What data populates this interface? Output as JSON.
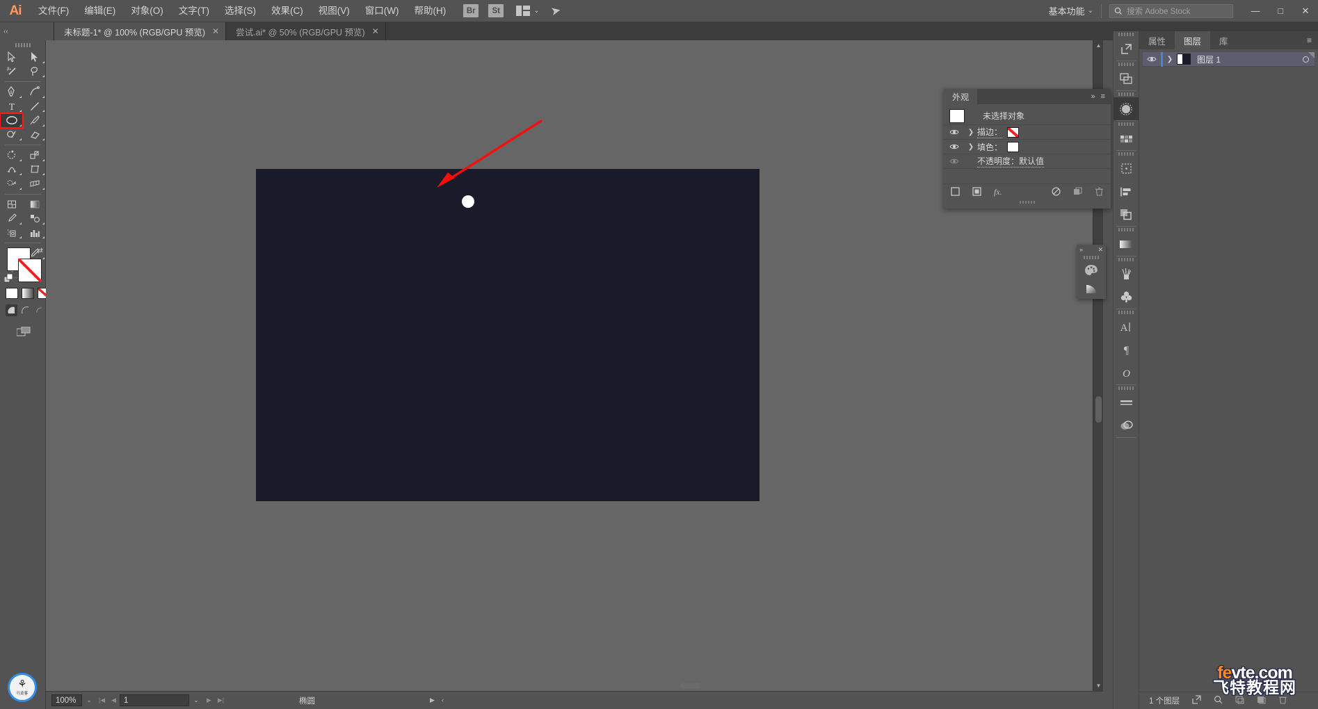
{
  "app": {
    "name": "Adobe Illustrator",
    "logo_text": "Ai",
    "accent_color": "#ff9a5c",
    "chrome_bg": "#535353"
  },
  "menubar": {
    "items": [
      {
        "label": "文件(F)",
        "name": "menu-file"
      },
      {
        "label": "编辑(E)",
        "name": "menu-edit"
      },
      {
        "label": "对象(O)",
        "name": "menu-object"
      },
      {
        "label": "文字(T)",
        "name": "menu-type"
      },
      {
        "label": "选择(S)",
        "name": "menu-select"
      },
      {
        "label": "效果(C)",
        "name": "menu-effect"
      },
      {
        "label": "视图(V)",
        "name": "menu-view"
      },
      {
        "label": "窗口(W)",
        "name": "menu-window"
      },
      {
        "label": "帮助(H)",
        "name": "menu-help"
      }
    ],
    "bridge_label": "Br",
    "stock_label": "St",
    "workspace": "基本功能",
    "search_placeholder": "搜索 Adobe Stock",
    "window_controls": {
      "minimize": "—",
      "maximize": "□",
      "close": "✕"
    }
  },
  "tabs": [
    {
      "title": "未标题-1* @ 100% (RGB/GPU 预览)",
      "active": true,
      "close": "✕"
    },
    {
      "title": "尝试.ai* @ 50% (RGB/GPU 预览)",
      "active": false,
      "close": "✕"
    }
  ],
  "toolbar": {
    "tools": [
      {
        "name": "selection-tool",
        "label": "选择工具"
      },
      {
        "name": "direct-selection-tool",
        "label": "直接选择工具"
      },
      {
        "name": "magic-wand-tool",
        "label": "魔棒工具"
      },
      {
        "name": "lasso-tool",
        "label": "套索工具"
      },
      {
        "name": "pen-tool",
        "label": "钢笔工具"
      },
      {
        "name": "curvature-tool",
        "label": "曲率工具"
      },
      {
        "name": "type-tool",
        "label": "文字工具"
      },
      {
        "name": "line-segment-tool",
        "label": "直线段工具"
      },
      {
        "name": "ellipse-tool",
        "label": "椭圆工具",
        "selected": true
      },
      {
        "name": "paintbrush-tool",
        "label": "画笔工具"
      },
      {
        "name": "shaper-tool",
        "label": "Shaper 工具"
      },
      {
        "name": "eraser-tool",
        "label": "橡皮擦工具"
      },
      {
        "name": "rotate-tool",
        "label": "旋转工具"
      },
      {
        "name": "scale-tool",
        "label": "比例缩放工具"
      },
      {
        "name": "width-tool",
        "label": "宽度工具"
      },
      {
        "name": "free-transform-tool",
        "label": "自由变换工具"
      },
      {
        "name": "shape-builder-tool",
        "label": "形状生成器工具"
      },
      {
        "name": "perspective-grid-tool",
        "label": "透视网格工具"
      },
      {
        "name": "mesh-tool",
        "label": "网格工具"
      },
      {
        "name": "gradient-tool",
        "label": "渐变工具"
      },
      {
        "name": "eyedropper-tool",
        "label": "吸管工具"
      },
      {
        "name": "blend-tool",
        "label": "混合工具"
      },
      {
        "name": "symbol-sprayer-tool",
        "label": "符号喷枪工具"
      },
      {
        "name": "column-graph-tool",
        "label": "柱形图工具"
      },
      {
        "name": "artboard-tool",
        "label": "画板工具"
      },
      {
        "name": "slice-tool",
        "label": "切片工具"
      },
      {
        "name": "hand-tool",
        "label": "抓手工具"
      },
      {
        "name": "zoom-tool",
        "label": "缩放工具"
      }
    ],
    "fill_color": "#ffffff",
    "stroke_color": "none",
    "selection_highlight_color": "#ff1a1a",
    "mini_swatches": [
      "色板",
      "渐变",
      "无"
    ],
    "draw_modes": [
      "正常绘图",
      "背面绘图",
      "内部绘图"
    ]
  },
  "brand_badge": {
    "symbol": "🦌",
    "text": "行走客"
  },
  "canvas": {
    "artboard_color": "#191a2a",
    "background_color": "#666666",
    "shape": {
      "name": "ellipse",
      "fill": "#ffffff",
      "label": "白色圆形"
    },
    "annotation": {
      "type": "arrow",
      "color": "#ff0000"
    }
  },
  "appearance_panel": {
    "tab_label": "外观",
    "collapse": "»",
    "menu": "≡",
    "no_selection": "未选择对象",
    "rows": [
      {
        "label": "描边：",
        "swatch": "none",
        "expandable": true,
        "visible": true
      },
      {
        "label": "填色：",
        "swatch": "#ffffff",
        "expandable": true,
        "visible": true
      },
      {
        "label": "不透明度：默认值",
        "swatch": null,
        "expandable": false,
        "visible": false
      }
    ],
    "footer_icons": [
      "添加新描边",
      "添加新填色",
      "添加新效果",
      "清除外观",
      "复制所选项目",
      "删除所选项目"
    ]
  },
  "mini_panel": {
    "collapse": "»",
    "close": "✕",
    "items": [
      "color-palette-icon",
      "gradient-icon"
    ]
  },
  "icon_dock": {
    "groups": [
      [
        "export-icon"
      ],
      [
        "artboards-icon"
      ],
      [
        "symbols-icon"
      ],
      [
        "swatches-grid-icon"
      ],
      [
        "transform-icon",
        "align-icon",
        "pathfinder-icon"
      ],
      [
        "gradient-panel-icon"
      ],
      [
        "brushes-icon",
        "symbols-library-icon"
      ],
      [
        "character-icon",
        "paragraph-icon",
        "opentype-icon"
      ],
      [
        "stroke-panel-icon",
        "transparency-icon"
      ]
    ],
    "active_group_index": 2
  },
  "right_panel": {
    "tabs": [
      {
        "label": "属性",
        "active": false
      },
      {
        "label": "图层",
        "active": true
      },
      {
        "label": "库",
        "active": false
      }
    ],
    "menu": "≡",
    "layers": [
      {
        "name": "图层 1",
        "visible": true,
        "locked": false,
        "selected": true
      }
    ],
    "footer": {
      "count_text": "1 个图层",
      "icons": [
        "locate-object-icon",
        "search-icon",
        "new-sublayer-icon",
        "new-layer-icon",
        "delete-layer-icon"
      ]
    }
  },
  "statusbar": {
    "zoom": "100%",
    "zoom_dropdown": "⌄",
    "page": "1",
    "page_dropdown": "⌄",
    "nav_first": "|◀",
    "nav_prev": "◀",
    "nav_next": "▶",
    "nav_last": "▶|",
    "current_tool": "椭圆",
    "expand": "▶",
    "collapse": "‹"
  },
  "watermark": {
    "line1_a": "fe",
    "line1_b": "vte.com",
    "line2": "飞特教程网"
  }
}
